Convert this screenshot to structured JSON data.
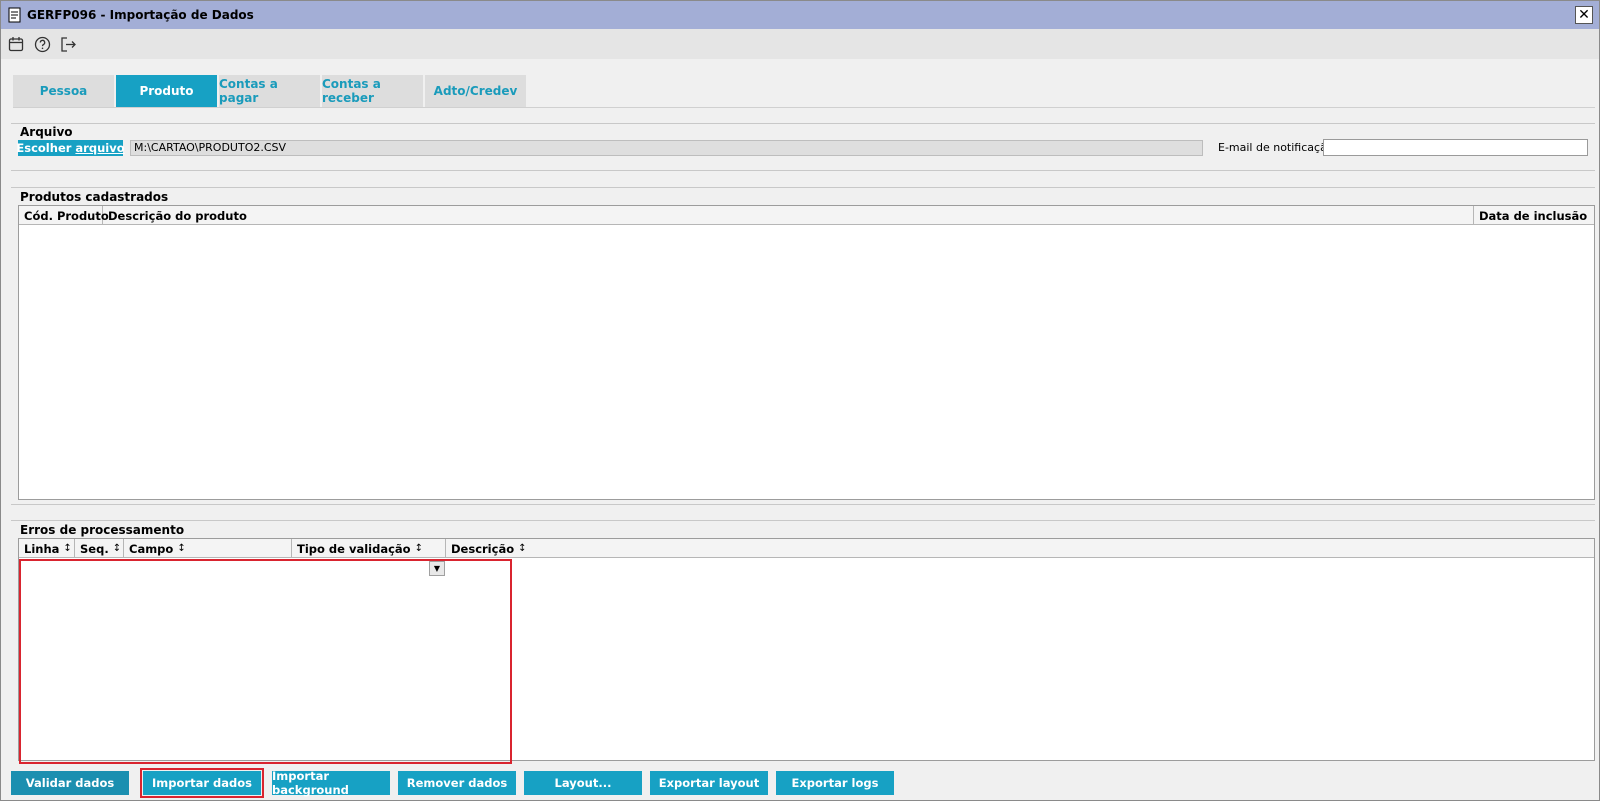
{
  "window": {
    "title": "GERFP096 - Importação de Dados",
    "close_label": "✕"
  },
  "toolbar": {
    "icons": [
      "calendar-icon",
      "help-icon",
      "exit-icon"
    ]
  },
  "tabs": [
    {
      "label": "Pessoa",
      "active": false
    },
    {
      "label": "Produto",
      "active": true
    },
    {
      "label": "Contas a pagar",
      "active": false
    },
    {
      "label": "Contas a receber",
      "active": false
    },
    {
      "label": "Adto/Credev",
      "active": false
    }
  ],
  "arquivo": {
    "title": "Arquivo",
    "choose_prefix": "Escolher ",
    "choose_underlined": "arquivo",
    "file_path": "M:\\CARTAO\\PRODUTO2.CSV",
    "email_label": "E-mail de notificação",
    "email_value": ""
  },
  "produtos": {
    "title": "Produtos cadastrados",
    "columns": [
      "Cód. Produto",
      "Descrição do produto",
      "Data de inclusão"
    ],
    "rows": []
  },
  "erros": {
    "title": "Erros de processamento",
    "columns": [
      "Linha",
      "Seq.",
      "Campo",
      "Tipo de validação",
      "Descrição"
    ],
    "sort_glyph": "↕",
    "rows": []
  },
  "actions": [
    {
      "label": "Validar dados"
    },
    {
      "label": "Importar dados"
    },
    {
      "label": "Importar background"
    },
    {
      "label": "Remover dados"
    },
    {
      "label": "Layout..."
    },
    {
      "label": "Exportar layout"
    },
    {
      "label": "Exportar logs"
    }
  ],
  "colors": {
    "accent": "#17a1c4",
    "titlebar": "#a3aed6",
    "highlight": "#d9242f"
  }
}
